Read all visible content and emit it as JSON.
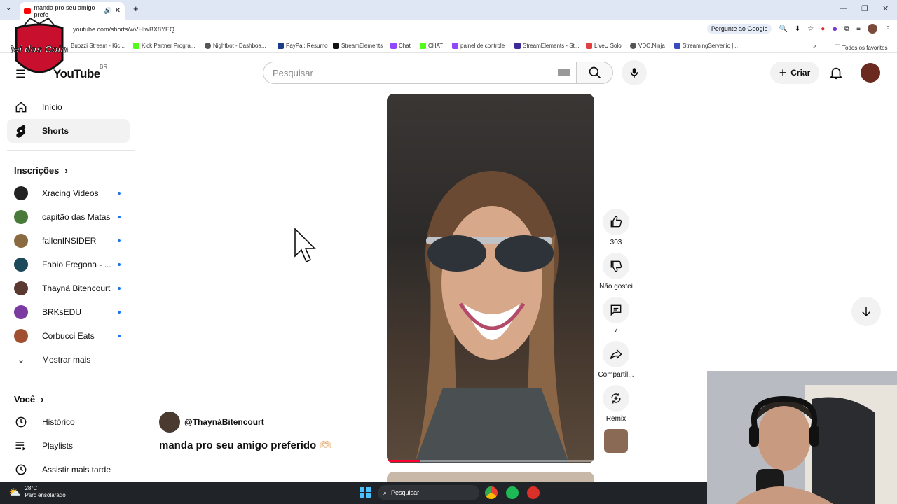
{
  "browser": {
    "tab_title": "manda pro seu amigo prefe",
    "url": "youtube.com/shorts/wVHIwBX8YEQ",
    "ask_google": "Pergunte ao Google",
    "bookmarks": [
      "Buozzi Stream - Kic...",
      "Kick Partner Progra...",
      "Nightbot - Dashboa...",
      "PayPal: Resumo",
      "StreamElements",
      "Chat",
      "CHAT",
      "painel de controle",
      "StreamElements - St...",
      "LiveU Solo",
      "VDO.Ninja",
      "StreamingServer.io |..."
    ],
    "all_favorites": "Todos os favoritos"
  },
  "overlay_logo": "Rei dos Coins",
  "header": {
    "logo": "YouTube",
    "region": "BR",
    "search_placeholder": "Pesquisar",
    "create_label": "Criar"
  },
  "sidebar": {
    "home": "Início",
    "shorts": "Shorts",
    "subscriptions_title": "Inscrições",
    "subscriptions": [
      {
        "name": "Xracing Videos",
        "color": "#222222"
      },
      {
        "name": "capitão das Matas",
        "color": "#4a7a3a"
      },
      {
        "name": "fallenINSIDER",
        "color": "#8a6a40"
      },
      {
        "name": "Fabio Fregona - ...",
        "color": "#1d4a5a"
      },
      {
        "name": "Thayná Bitencourt",
        "color": "#5a3a30"
      },
      {
        "name": "BRKsEDU",
        "color": "#7a3aa0"
      },
      {
        "name": "Corbucci Eats",
        "color": "#a05030"
      }
    ],
    "show_more": "Mostrar mais",
    "you_title": "Você",
    "you_items": [
      "Histórico",
      "Playlists",
      "Assistir mais tarde"
    ]
  },
  "short": {
    "channel": "@ThaynáBitencourt",
    "title": "manda pro seu amigo preferido 🫶🏻",
    "progress": 0.16,
    "likes": "303",
    "dislike_label": "Não gostei",
    "comments": "7",
    "share_label": "Compartil...",
    "remix_label": "Remix"
  },
  "taskbar": {
    "temperature": "28°C",
    "weather": "Parc ensolarado",
    "search": "Pesquisar"
  }
}
